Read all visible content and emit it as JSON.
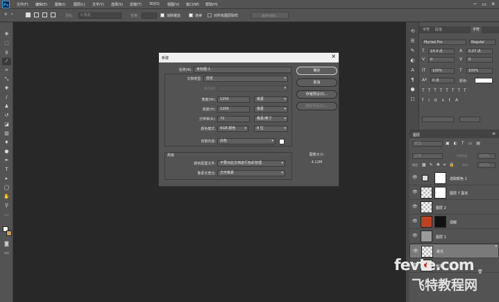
{
  "app": {
    "logo": "Ps"
  },
  "menu": [
    "文件(F)",
    "编辑(E)",
    "图像(I)",
    "图层(L)",
    "文字(Y)",
    "选择(S)",
    "滤镜(T)",
    "3D(D)",
    "视图(V)",
    "窗口(W)",
    "帮助(H)"
  ],
  "window_controls": {
    "minimize": "─",
    "restore": "▭",
    "close": "✕"
  },
  "options_bar": {
    "feather_label": "羽化:",
    "feather_value": "0 像素",
    "tolerance_label": "容差:",
    "tolerance_value": "",
    "antialias_label": "消除锯齿",
    "antialias_checked": true,
    "contiguous_label": "连续",
    "contiguous_checked": true,
    "all_layers_label": "对所有图层取样",
    "all_layers_checked": false,
    "refine_edge_label": "选择并遮住..."
  },
  "dialog": {
    "title": "新建",
    "close_glyph": "✕",
    "name_label": "名称(N):",
    "name_value": "未标题-1",
    "preset_label": "文档类型:",
    "preset_value": "自定",
    "size_label": "大小(I):",
    "size_value": "",
    "width_label": "宽度(W):",
    "width_value": "1200",
    "width_unit": "像素",
    "height_label": "高度(H):",
    "height_value": "1200",
    "height_unit": "像素",
    "resolution_label": "分辨率(R):",
    "resolution_value": "72",
    "resolution_unit": "像素/英寸",
    "color_mode_label": "颜色模式:",
    "color_mode_value": "RGB 颜色",
    "bit_depth_value": "8 位",
    "background_label": "背景内容:",
    "background_value": "白色",
    "advanced_label": "高级",
    "color_profile_label": "颜色配置文件:",
    "color_profile_value": "不要对此文档进行色彩管理",
    "pixel_aspect_label": "像素长宽比:",
    "pixel_aspect_value": "方形像素",
    "ok_button": "确定",
    "cancel_button": "取消",
    "save_preset_button": "存储预设(S)...",
    "delete_preset_button": "删除预设(D)...",
    "image_size_label": "图像大小:",
    "image_size_value": "4.12M"
  },
  "character_panel": {
    "tabs": [
      "字符",
      "段落",
      "字符"
    ],
    "active_tab": 2,
    "font_family": "Myriad Pro",
    "font_style": "Regular",
    "font_size": "14.4 点",
    "leading": "5.07 点",
    "tracking": "0",
    "kerning": "0",
    "vertical_scale": "100%",
    "horizontal_scale": "100%",
    "baseline_shift": "0 点",
    "color_label": "颜色:",
    "accent_color": "#ffffff"
  },
  "layers_panel": {
    "title": "图层",
    "kind_label": "类型",
    "blend_mode": "正常",
    "opacity_label": "不透明度:",
    "opacity_value": "100%",
    "lock_label": "锁定:",
    "fill_label": "填充:",
    "fill_value": "100%",
    "layers": [
      {
        "name": "选取颜色 1",
        "type": "adjustment"
      },
      {
        "name": "图层 7 副本",
        "type": "pixel"
      },
      {
        "name": "图层 2",
        "type": "pixel"
      },
      {
        "name": "润眼",
        "type": "mask"
      },
      {
        "name": "图层 1",
        "type": "pixel"
      },
      {
        "name": "柔光",
        "type": "pixel",
        "selected": true
      },
      {
        "name": "苹果",
        "type": "pixel"
      }
    ]
  },
  "watermark": {
    "line1": "fevte.com",
    "line2": "飞特教程网"
  }
}
